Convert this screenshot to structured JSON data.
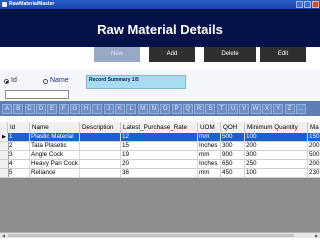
{
  "window": {
    "title": "RawMaterialMaster"
  },
  "header": {
    "title": "Raw Material Details"
  },
  "toolbar": {
    "new_label": "New",
    "add_label": "Add",
    "delete_label": "Delete",
    "edit_label": "Edit"
  },
  "search": {
    "option_id": "Id",
    "option_name": "Name",
    "selected": "Id",
    "query": "",
    "summary": "Record Summary 1/5"
  },
  "alphabet": [
    "A",
    "B",
    "C",
    "D",
    "E",
    "F",
    "G",
    "H",
    "I",
    "J",
    "K",
    "L",
    "M",
    "N",
    "O",
    "P",
    "Q",
    "R",
    "S",
    "T",
    "U",
    "V",
    "W",
    "X",
    "Y",
    "Z",
    "..."
  ],
  "grid": {
    "columns": [
      "Id",
      "Name",
      "Description",
      "Latest_Purchase_Rate",
      "UOM",
      "QOH",
      "Minimum Quantity",
      "Ma"
    ],
    "rows": [
      [
        "1",
        "Plastic Material",
        "",
        "12",
        "mm",
        "500",
        "100",
        "150"
      ],
      [
        "2",
        "Tata Plasetic",
        "",
        "15",
        "Inches",
        "300",
        "200",
        "200"
      ],
      [
        "3",
        "Angle Cock",
        "",
        "19",
        "mm",
        "900",
        "300",
        "500"
      ],
      [
        "4",
        "Heavy Pan Cock",
        "",
        "20",
        "Inches",
        "650",
        "250",
        "200"
      ],
      [
        "5",
        "Reliance",
        "",
        "36",
        "mm",
        "450",
        "100",
        "230"
      ]
    ],
    "selected_row": 0
  },
  "colors": {
    "header_bg": "#08124a",
    "selection": "#1e5fd0",
    "alphabet_bar": "#5f7fb4",
    "summary_bg": "#a8dcf0"
  }
}
